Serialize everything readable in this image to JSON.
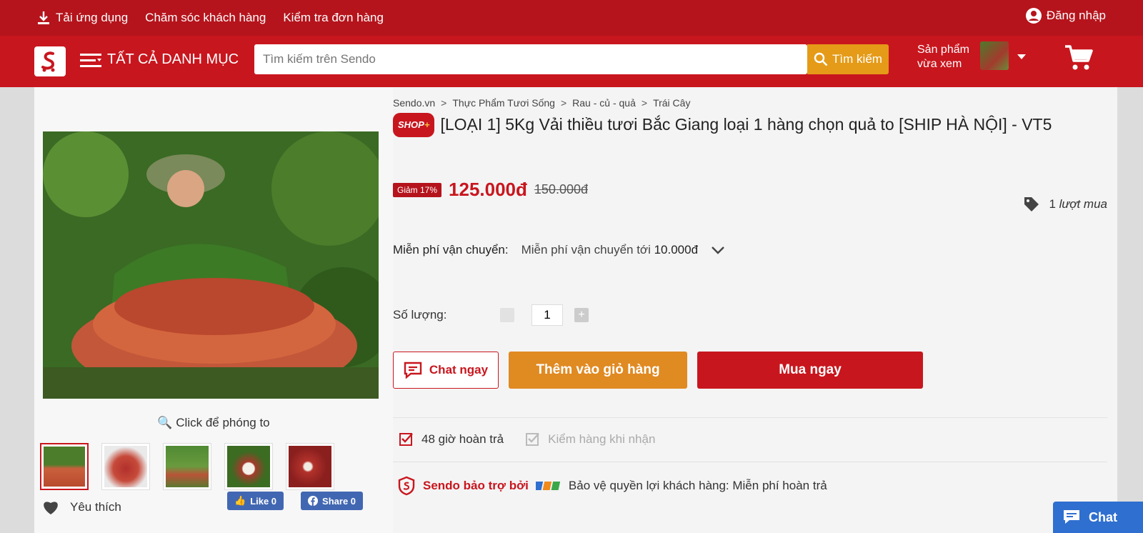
{
  "topbar": {
    "download_app": "Tải ứng dụng",
    "customer_care": "Chăm sóc khách hàng",
    "check_order": "Kiểm tra đơn hàng",
    "login": "Đăng nhập"
  },
  "header": {
    "all_categories": "TẤT CẢ DANH MỤC",
    "search_placeholder": "Tìm kiếm trên Sendo",
    "search_button": "Tìm kiếm",
    "recent_line1": "Sản phẩm",
    "recent_line2": "vừa xem"
  },
  "breadcrumb": [
    "Sendo.vn",
    "Thực Phẩm Tươi Sống",
    "Rau - củ - quả",
    "Trái Cây"
  ],
  "product": {
    "shop_badge": "SHOP",
    "shop_badge_plus": "+",
    "title": "[LOẠI 1] 5Kg Vải thiều tươi Bắc Giang loại 1 hàng chọn quả to [SHIP HÀ NỘI] - VT5",
    "discount": "Giảm 17%",
    "price": "125.000đ",
    "old_price": "150.000đ",
    "bought_count": "1",
    "bought_label": "lượt mua",
    "shipping_label": "Miễn phí vận chuyển:",
    "shipping_text": "Miễn phí vận chuyển tới",
    "shipping_amount": "10.000đ",
    "quantity_label": "Số lượng:",
    "quantity_value": "1",
    "zoom_hint": "Click để phóng to",
    "favorite": "Yêu thích",
    "fb_like": "Like 0",
    "fb_share": "Share 0"
  },
  "actions": {
    "chat": "Chat ngay",
    "add_to_cart": "Thêm vào giỏ hàng",
    "buy_now": "Mua ngay"
  },
  "policies": {
    "return": "48 giờ hoàn trả",
    "inspect": "Kiểm hàng khi nhận",
    "sponsored_by": "Sendo bảo trợ bởi",
    "protection": "Bảo vệ quyền lợi khách hàng: Miễn phí hoàn trả"
  },
  "chat_fab": "Chat",
  "colors": {
    "brand_red": "#c8161e",
    "accent_orange": "#e08a22",
    "facebook_blue": "#4267b2",
    "chat_blue": "#2f6fcf"
  }
}
